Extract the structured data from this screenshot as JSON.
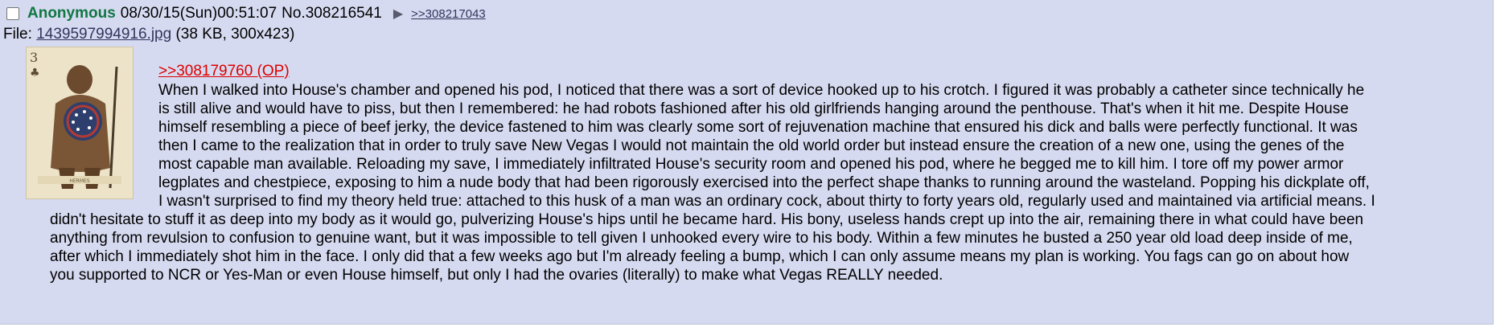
{
  "post": {
    "name": "Anonymous",
    "datetime": "08/30/15(Sun)00:51:07",
    "number": "No.308216541",
    "menu_icon": "▶",
    "backlink": ">>308217043",
    "file": {
      "label": "File:",
      "filename": "1439597994916.jpg",
      "details": "(38 KB, 300x423)"
    },
    "thumbnail": {
      "card_rank": "3",
      "card_suit": "♣",
      "caption": "HERMES"
    },
    "quote_link": ">>308179760 (OP)",
    "lines": [
      "When I walked into House's chamber and opened his pod, I noticed that there was a sort of device hooked up to his crotch. I figured it was probably a catheter since technically he",
      "is still alive and would have to piss, but then I remembered: he had robots fashioned after his old girlfriends hanging around the penthouse. That's when it hit me. Despite House",
      "himself resembling a piece of beef jerky, the device fastened to him was clearly some sort of rejuvenation machine that ensured his dick and balls were perfectly functional. It was",
      "then I came to the realization that in order to truly save New Vegas I would not maintain the old world order but instead ensure the creation of a new one, using the genes of the",
      "most capable man available. Reloading my save, I immediately infiltrated House's security room and opened his pod, where he begged me to kill him. I tore off my power armor",
      "legplates and chestpiece, exposing to him a nude body that had been rigorously exercised into the perfect shape thanks to running around the wasteland. Popping his dickplate off,",
      "I wasn't surprised to find my theory held true: attached to this husk of a man was an ordinary cock, about thirty to forty years old, regularly used and maintained via artificial means. I",
      "didn't hesitate to stuff it as deep into my body as it would go, pulverizing House's hips until he became hard. His bony, useless hands crept up into the air, remaining there in what could have been",
      "anything from revulsion to confusion to genuine want, but it was impossible to tell given I unhooked every wire to his body. Within a few minutes he busted a 250 year old load deep inside of me,",
      "after which I immediately shot him in the face. I only did that a few weeks ago but I'm already feeling a bump, which I can only assume means my plan is working. You fags can go on about how",
      "you supported to NCR or Yes-Man or even House himself, but only I had the ovaries (literally) to make what Vegas REALLY needed."
    ]
  },
  "colors": {
    "post_bg": "#d6daf0",
    "name": "#117743",
    "quote_link": "#dd0000",
    "link": "#34345c"
  }
}
